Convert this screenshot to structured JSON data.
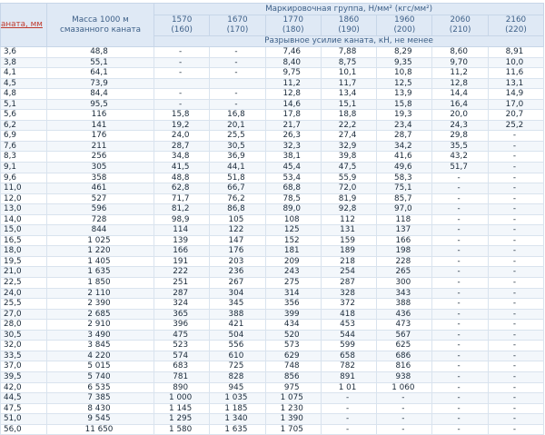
{
  "header": {
    "diameter_label": "аната, мм",
    "mass_label": "Масса 1000 м смазанного каната",
    "group_label": "Маркировочная группа, Н/мм² (кгс/мм²)",
    "force_label": "Разрывное усилие каната, кН, не менее",
    "grades": [
      {
        "n": "1570",
        "kgf": "(160)"
      },
      {
        "n": "1670",
        "kgf": "(170)"
      },
      {
        "n": "1770",
        "kgf": "(180)"
      },
      {
        "n": "1860",
        "kgf": "(190)"
      },
      {
        "n": "1960",
        "kgf": "(200)"
      },
      {
        "n": "2060",
        "kgf": "(210)"
      },
      {
        "n": "2160",
        "kgf": "(220)"
      }
    ]
  },
  "rows": [
    [
      "3,6",
      "48,8",
      "-",
      "-",
      "7,46",
      "7,88",
      "8,29",
      "8,60",
      "8,91"
    ],
    [
      "3,8",
      "55,1",
      "-",
      "-",
      "8,40",
      "8,75",
      "9,35",
      "9,70",
      "10,0"
    ],
    [
      "4,1",
      "64,1",
      "-",
      "-",
      "9,75",
      "10,1",
      "10,8",
      "11,2",
      "11,6"
    ],
    [
      "4,5",
      "73,9",
      "",
      "",
      "11,2",
      "11,7",
      "12,5",
      "12,8",
      "13,1"
    ],
    [
      "4,8",
      "84,4",
      "-",
      "-",
      "12,8",
      "13,4",
      "13,9",
      "14,4",
      "14,9"
    ],
    [
      "5,1",
      "95,5",
      "-",
      "-",
      "14,6",
      "15,1",
      "15,8",
      "16,4",
      "17,0"
    ],
    [
      "5,6",
      "116",
      "15,8",
      "16,8",
      "17,8",
      "18,8",
      "19,3",
      "20,0",
      "20,7"
    ],
    [
      "6,2",
      "141",
      "19,2",
      "20,1",
      "21,7",
      "22,2",
      "23,4",
      "24,3",
      "25,2"
    ],
    [
      "6,9",
      "176",
      "24,0",
      "25,5",
      "26,3",
      "27,4",
      "28,7",
      "29,8",
      "-"
    ],
    [
      "7,6",
      "211",
      "28,7",
      "30,5",
      "32,3",
      "32,9",
      "34,2",
      "35,5",
      "-"
    ],
    [
      "8,3",
      "256",
      "34,8",
      "36,9",
      "38,1",
      "39,8",
      "41,6",
      "43,2",
      "-"
    ],
    [
      "9,1",
      "305",
      "41,5",
      "44,1",
      "45,4",
      "47,5",
      "49,6",
      "51,7",
      "-"
    ],
    [
      "9,6",
      "358",
      "48,8",
      "51,8",
      "53,4",
      "55,9",
      "58,3",
      "-",
      "-"
    ],
    [
      "11,0",
      "461",
      "62,8",
      "66,7",
      "68,8",
      "72,0",
      "75,1",
      "-",
      "-"
    ],
    [
      "12,0",
      "527",
      "71,7",
      "76,2",
      "78,5",
      "81,9",
      "85,7",
      "-",
      "-"
    ],
    [
      "13,0",
      "596",
      "81,2",
      "86,8",
      "89,0",
      "92,8",
      "97,0",
      "-",
      "-"
    ],
    [
      "14,0",
      "728",
      "98,9",
      "105",
      "108",
      "112",
      "118",
      "-",
      "-"
    ],
    [
      "15,0",
      "844",
      "114",
      "122",
      "125",
      "131",
      "137",
      "-",
      "-"
    ],
    [
      "16,5",
      "1 025",
      "139",
      "147",
      "152",
      "159",
      "166",
      "-",
      "-"
    ],
    [
      "18,0",
      "1 220",
      "166",
      "176",
      "181",
      "189",
      "198",
      "-",
      "-"
    ],
    [
      "19,5",
      "1 405",
      "191",
      "203",
      "209",
      "218",
      "228",
      "-",
      "-"
    ],
    [
      "21,0",
      "1 635",
      "222",
      "236",
      "243",
      "254",
      "265",
      "-",
      "-"
    ],
    [
      "22,5",
      "1 850",
      "251",
      "267",
      "275",
      "287",
      "300",
      "-",
      "-"
    ],
    [
      "24,0",
      "2 110",
      "287",
      "304",
      "314",
      "328",
      "343",
      "-",
      "-"
    ],
    [
      "25,5",
      "2 390",
      "324",
      "345",
      "356",
      "372",
      "388",
      "-",
      "-"
    ],
    [
      "27,0",
      "2 685",
      "365",
      "388",
      "399",
      "418",
      "436",
      "-",
      "-"
    ],
    [
      "28,0",
      "2 910",
      "396",
      "421",
      "434",
      "453",
      "473",
      "-",
      "-"
    ],
    [
      "30,5",
      "3 490",
      "475",
      "504",
      "520",
      "544",
      "567",
      "-",
      "-"
    ],
    [
      "32,0",
      "3 845",
      "523",
      "556",
      "573",
      "599",
      "625",
      "-",
      "-"
    ],
    [
      "33,5",
      "4 220",
      "574",
      "610",
      "629",
      "658",
      "686",
      "-",
      "-"
    ],
    [
      "37,0",
      "5 015",
      "683",
      "725",
      "748",
      "782",
      "816",
      "-",
      "-"
    ],
    [
      "39,5",
      "5 740",
      "781",
      "828",
      "856",
      "891",
      "938",
      "-",
      "-"
    ],
    [
      "42,0",
      "6 535",
      "890",
      "945",
      "975",
      "1 01",
      "1 060",
      "-",
      "-"
    ],
    [
      "44,5",
      "7 385",
      "1 000",
      "1 035",
      "1 075",
      "-",
      "-",
      "-",
      "-"
    ],
    [
      "47,5",
      "8 430",
      "1 145",
      "1 185",
      "1 230",
      "-",
      "-",
      "-",
      "-"
    ],
    [
      "51,0",
      "9 545",
      "1 295",
      "1 340",
      "1 390",
      "-",
      "-",
      "-",
      "-"
    ],
    [
      "56,0",
      "11 650",
      "1 580",
      "1 635",
      "1 705",
      "-",
      "-",
      "-",
      "-"
    ]
  ]
}
